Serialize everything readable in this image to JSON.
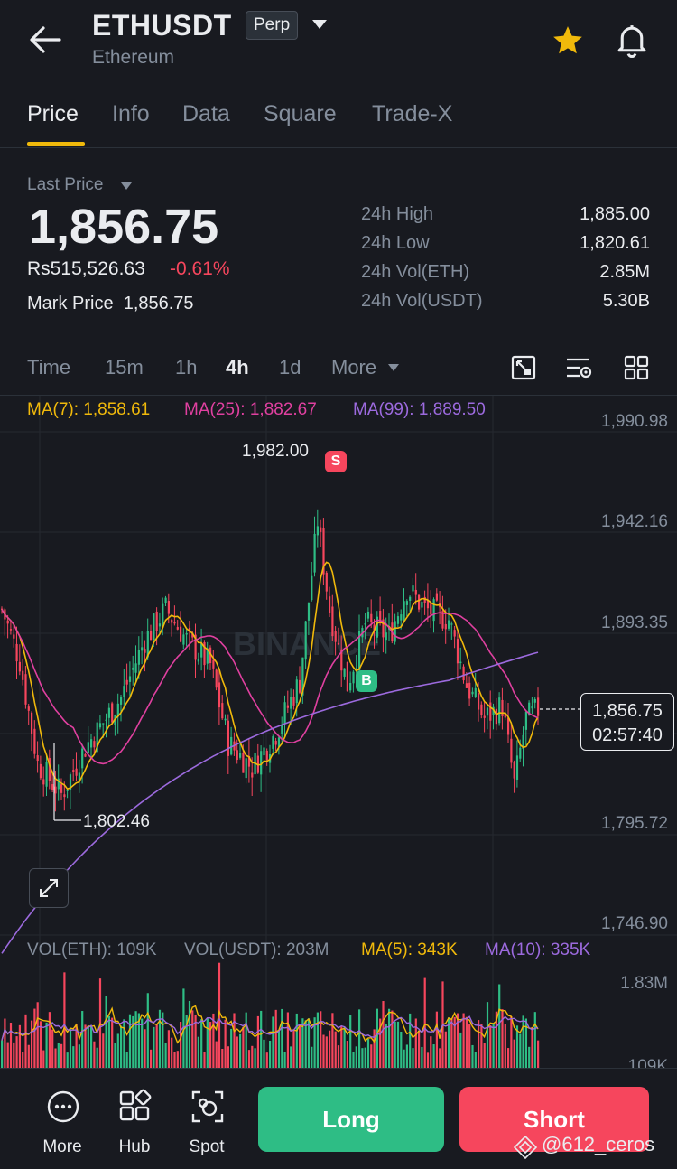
{
  "header": {
    "symbol": "ETHUSDT",
    "badge": "Perp",
    "subtitle": "Ethereum",
    "star_color": "#f0b90b"
  },
  "tabs": [
    {
      "label": "Price",
      "active": true
    },
    {
      "label": "Info"
    },
    {
      "label": "Data"
    },
    {
      "label": "Square"
    },
    {
      "label": "Trade-X"
    }
  ],
  "price": {
    "last_price_label": "Last Price",
    "last_price": "1,856.75",
    "local": "Rs515,526.63",
    "change": "-0.61%",
    "mark_label": "Mark Price",
    "mark_value": "1,856.75"
  },
  "stats": [
    {
      "label": "24h High",
      "value": "1,885.00"
    },
    {
      "label": "24h Low",
      "value": "1,820.61"
    },
    {
      "label": "24h Vol(ETH)",
      "value": "2.85M"
    },
    {
      "label": "24h Vol(USDT)",
      "value": "5.30B"
    }
  ],
  "timeframes": {
    "items": [
      "Time",
      "15m",
      "1h",
      "4h",
      "1d"
    ],
    "active": "4h",
    "more": "More"
  },
  "ma": {
    "ma7": "MA(7): 1,858.61",
    "ma25": "MA(25): 1,882.67",
    "ma99": "MA(99): 1,889.50",
    "colors": {
      "ma7": "#f0b90b",
      "ma25": "#e040a0",
      "ma99": "#9c6ade"
    }
  },
  "axis": {
    "price_ticks": [
      "1,990.98",
      "1,942.16",
      "1,893.35",
      "1,795.72",
      "1,746.90"
    ],
    "vol_tick": "1.83M",
    "vol_tick_low": "109K"
  },
  "annotations": {
    "high": "1,982.00",
    "low": "1,802.46",
    "sell": "S",
    "buy": "B",
    "current_price": "1,856.75",
    "countdown": "02:57:40"
  },
  "watermark_brand": "BINANCE",
  "volume": {
    "eth": "VOL(ETH): 109K",
    "usdt": "VOL(USDT): 203M",
    "ma5": "MA(5): 343K",
    "ma10": "MA(10): 335K"
  },
  "bottom": {
    "more": "More",
    "hub": "Hub",
    "spot": "Spot",
    "long": "Long",
    "short": "Short",
    "long_color": "#2ebd85",
    "short_color": "#f6465d"
  },
  "watermark_user": "@612_ceros",
  "chart_data": {
    "type": "candlestick",
    "timeframe": "4h",
    "price_range": [
      1746.9,
      1990.98
    ],
    "volume_top": "1.83M",
    "high_marker": 1982.0,
    "low_marker": 1802.46,
    "last": 1856.75
  }
}
